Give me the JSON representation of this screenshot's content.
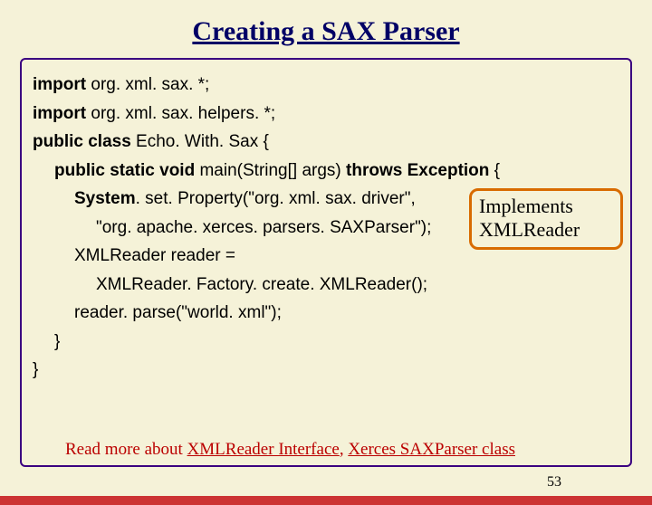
{
  "title": "Creating a SAX Parser",
  "code": {
    "l1a": "import",
    "l1b": " org. xml. sax. *;",
    "l2a": "import",
    "l2b": " org. xml. sax. helpers. *;",
    "l3a": "public class",
    "l3b": " Echo. With. Sax {",
    "l4a": "public static void",
    "l4b": " main(String[] args) ",
    "l4c": "throws Exception",
    "l4d": " {",
    "l5a": "System",
    "l5b": ". set. Property(\"org. xml. sax. driver\",",
    "l6": "\"org. apache. xerces. parsers. SAXParser\");",
    "l7": "XMLReader reader =",
    "l8": "XMLReader. Factory. create. XMLReader();",
    "l9": "reader. parse(\"world. xml\");",
    "l10": "}",
    "l11": "}"
  },
  "callout": {
    "line1": "Implements",
    "line2": "XMLReader"
  },
  "footer": {
    "prefix": "Read more about ",
    "link1": "XMLReader Interface",
    "sep": ", ",
    "link2": "Xerces SAXParser class"
  },
  "pagenum": "53"
}
